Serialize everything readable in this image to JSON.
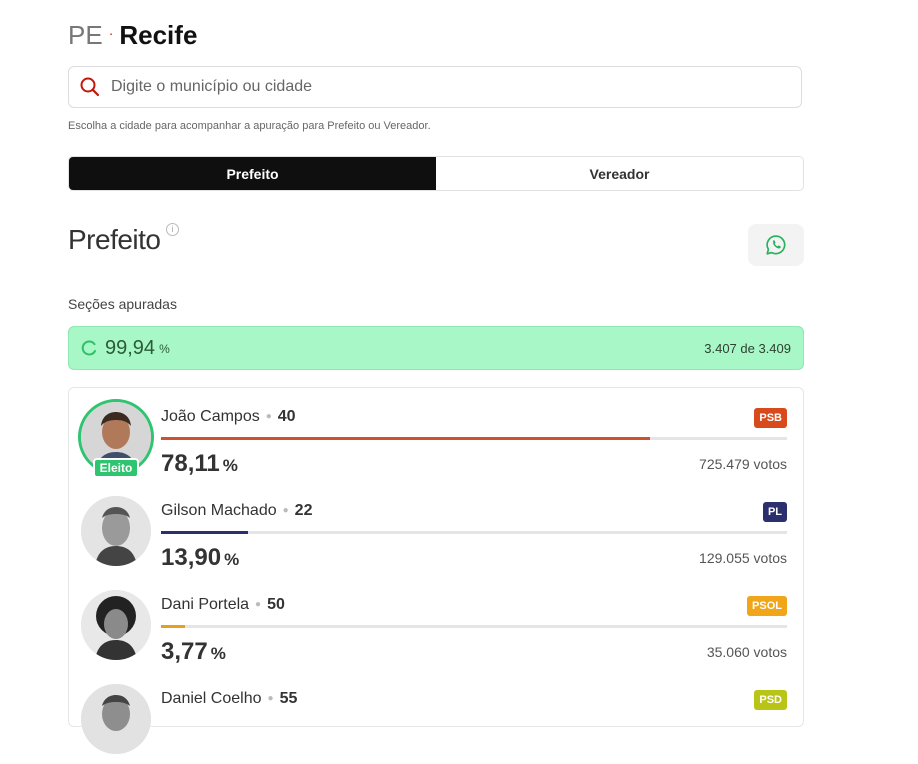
{
  "location": {
    "state": "PE",
    "separator": "·",
    "city": "Recife"
  },
  "search": {
    "placeholder": "Digite o município ou cidade",
    "hint": "Escolha a cidade para acompanhar a apuração para Prefeito ou Vereador."
  },
  "tabs": [
    {
      "label": "Prefeito",
      "active": true
    },
    {
      "label": "Vereador",
      "active": false
    }
  ],
  "section": {
    "title": "Prefeito",
    "info_icon": "info-icon",
    "share_icon": "whatsapp-icon"
  },
  "progress": {
    "label": "Seções apuradas",
    "percent": "99,94",
    "percent_symbol": "%",
    "count": "3.407 de 3.409",
    "color": "#a8f7c6"
  },
  "candidates": [
    {
      "name": "João Campos",
      "number": "40",
      "party": "PSB",
      "party_color": "#d84a1b",
      "percent": "78,11",
      "percent_symbol": "%",
      "votes": "725.479 votos",
      "bar_fraction": 0.7811,
      "bar_color": "#cf5230",
      "elected": true,
      "elected_label": "Eleito"
    },
    {
      "name": "Gilson Machado",
      "number": "22",
      "party": "PL",
      "party_color": "#2c2f6e",
      "percent": "13,90",
      "percent_symbol": "%",
      "votes": "129.055 votos",
      "bar_fraction": 0.139,
      "bar_color": "#2c2f6e",
      "elected": false
    },
    {
      "name": "Dani Portela",
      "number": "50",
      "party": "PSOL",
      "party_color": "#f0a51b",
      "percent": "3,77",
      "percent_symbol": "%",
      "votes": "35.060 votos",
      "bar_fraction": 0.0377,
      "bar_color": "#e6a11a",
      "elected": false
    },
    {
      "name": "Daniel Coelho",
      "number": "55",
      "party": "PSD",
      "party_color": "#b8c416",
      "elected": false
    }
  ]
}
